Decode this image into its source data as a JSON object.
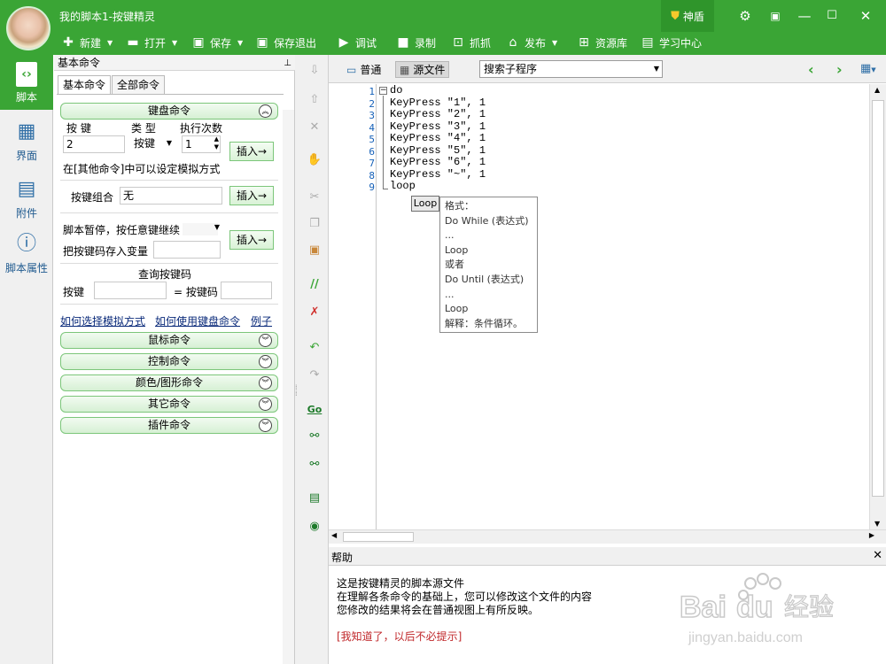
{
  "window": {
    "title": "我的脚本1-按键精灵",
    "shield_label": "神盾",
    "accent": "#3aa535"
  },
  "toolbar": {
    "new_label": "新建",
    "open_label": "打开",
    "save_label": "保存",
    "save_exit_label": "保存退出",
    "debug_label": "调试",
    "record_label": "录制",
    "capture_label": "抓抓",
    "publish_label": "发布",
    "resource_label": "资源库",
    "learn_label": "学习中心"
  },
  "leftnav": {
    "items": [
      {
        "label": "脚本",
        "icon": "script-icon",
        "active": true
      },
      {
        "label": "界面",
        "icon": "layout-icon"
      },
      {
        "label": "附件",
        "icon": "attachment-icon"
      },
      {
        "label": "脚本属性",
        "icon": "info-icon"
      }
    ]
  },
  "panel": {
    "title": "基本命令",
    "tabs": [
      "基本命令",
      "全部命令"
    ],
    "keyboard": {
      "header": "键盘命令",
      "key_label": "按 键",
      "key_value": "2",
      "type_label": "类 型",
      "type_value": "按键",
      "count_label": "执行次数",
      "count_value": "1",
      "insert": "插入→",
      "note": "在[其他命令]中可以设定模拟方式",
      "combo_label": "按键组合",
      "combo_value": "无",
      "pause_label": "脚本暂停，按任意键继续",
      "store_label": "把按键码存入变量",
      "query_title": "查询按键码",
      "query_key_label": "按键",
      "query_code_label": "= 按键码",
      "link1": "如何选择模拟方式",
      "link2": "如何使用键盘命令",
      "link3": "例子"
    },
    "sections": [
      "鼠标命令",
      "控制命令",
      "颜色/图形命令",
      "其它命令",
      "插件命令"
    ]
  },
  "editor": {
    "tab_normal": "普通",
    "tab_source": "源文件",
    "sub_placeholder": "搜索子程序",
    "lines": [
      "do",
      "KeyPress \"1\", 1",
      "KeyPress \"2\", 1",
      "KeyPress \"3\", 1",
      "KeyPress \"4\", 1",
      "KeyPress \"5\", 1",
      "KeyPress \"6\", 1",
      "KeyPress \"~\", 1",
      "loop"
    ],
    "line_numbers": [
      "1",
      "2",
      "3",
      "4",
      "5",
      "6",
      "7",
      "8",
      "9"
    ],
    "autocomplete": "Loop",
    "tooltip": [
      "格式：",
      "Do While (表达式)",
      "...",
      "Loop",
      "或者",
      "Do Until (表达式)",
      "...",
      "Loop",
      "解释：条件循环。"
    ]
  },
  "help": {
    "title": "帮助",
    "line1": "这是按键精灵的脚本源文件",
    "line2": "在理解各条命令的基础上，您可以修改这个文件的内容",
    "line3": "您修改的结果将会在普通视图上有所反映。",
    "dismiss": "[我知道了，以后不必提示]"
  },
  "watermark": {
    "logo": "Bai经验",
    "url": "jingyan.baidu.com"
  }
}
